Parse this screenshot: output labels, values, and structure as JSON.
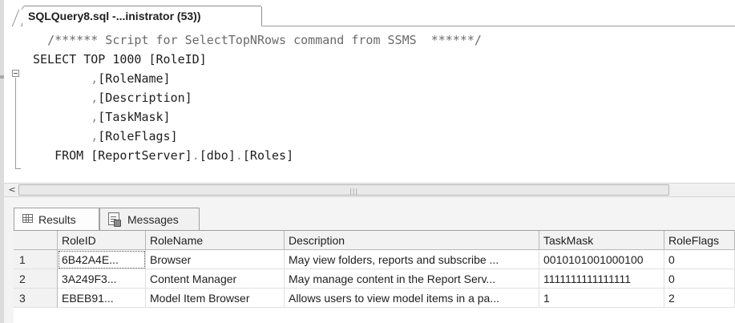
{
  "document_tab": {
    "title": "SQLQuery8.sql -...inistrator (53))"
  },
  "editor": {
    "lines": [
      {
        "indent": "  ",
        "parts": [
          {
            "cls": "c-comment",
            "text": "/****** Script for SelectTopNRows command from SSMS  ******/"
          }
        ]
      },
      {
        "indent": "",
        "parts": [
          {
            "cls": "c-kw",
            "text": "SELECT TOP 1000 [RoleID]"
          }
        ]
      },
      {
        "indent": "        ",
        "parts": [
          {
            "cls": "c-punct",
            "text": ","
          },
          {
            "cls": "c-kw",
            "text": "[RoleName]"
          }
        ]
      },
      {
        "indent": "        ",
        "parts": [
          {
            "cls": "c-punct",
            "text": ","
          },
          {
            "cls": "c-kw",
            "text": "[Description]"
          }
        ]
      },
      {
        "indent": "        ",
        "parts": [
          {
            "cls": "c-punct",
            "text": ","
          },
          {
            "cls": "c-kw",
            "text": "[TaskMask]"
          }
        ]
      },
      {
        "indent": "        ",
        "parts": [
          {
            "cls": "c-punct",
            "text": ","
          },
          {
            "cls": "c-kw",
            "text": "[RoleFlags]"
          }
        ]
      },
      {
        "indent": "   ",
        "parts": [
          {
            "cls": "c-kw",
            "text": "FROM [ReportServer]"
          },
          {
            "cls": "c-punct",
            "text": "."
          },
          {
            "cls": "c-kw",
            "text": "[dbo]"
          },
          {
            "cls": "c-punct",
            "text": "."
          },
          {
            "cls": "c-kw",
            "text": "[Roles]"
          }
        ]
      }
    ]
  },
  "scrollbar": {
    "left_arrow": "<",
    "grip": "|||"
  },
  "results": {
    "tabs": [
      {
        "label": "Results",
        "icon": "grid-icon"
      },
      {
        "label": "Messages",
        "icon": "messages-icon"
      }
    ],
    "columns": [
      "RoleID",
      "RoleName",
      "Description",
      "TaskMask",
      "RoleFlags"
    ],
    "rows": [
      {
        "num": "1",
        "cells": [
          "6B42A4E...",
          "Browser",
          "May view folders, reports and subscribe ...",
          "0010101001000100",
          "0"
        ]
      },
      {
        "num": "2",
        "cells": [
          "3A249F3...",
          "Content Manager",
          "May manage content in the Report Serv...",
          "1111111111111111",
          "0"
        ]
      },
      {
        "num": "3",
        "cells": [
          "EBEB91...",
          "Model Item Browser",
          "Allows users to view model items in a pa...",
          "1",
          "2"
        ]
      }
    ]
  }
}
